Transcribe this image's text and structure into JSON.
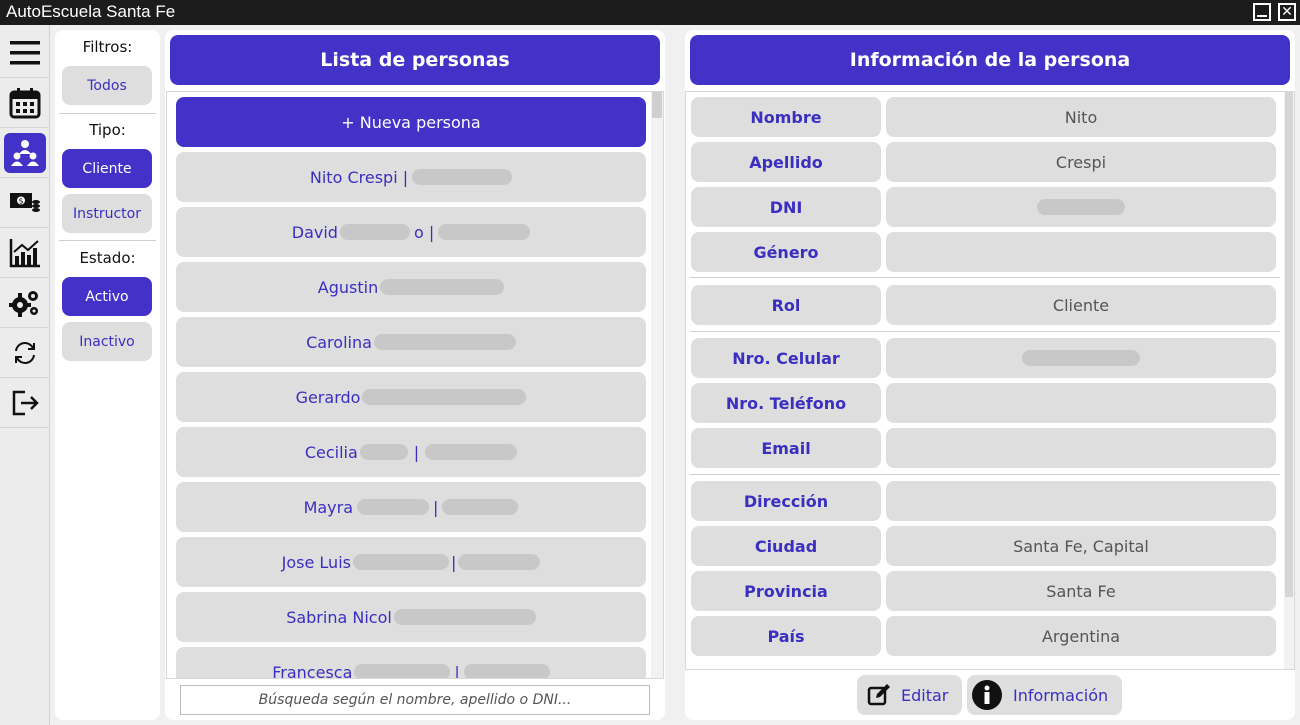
{
  "window": {
    "title": "AutoEscuela Santa Fe"
  },
  "nav": {
    "items": [
      {
        "name": "menu-icon"
      },
      {
        "name": "calendar-icon"
      },
      {
        "name": "people-icon",
        "active": true
      },
      {
        "name": "money-icon"
      },
      {
        "name": "chart-icon"
      },
      {
        "name": "settings-icon"
      },
      {
        "name": "sync-icon"
      },
      {
        "name": "logout-icon"
      }
    ]
  },
  "filters": {
    "title": "Filtros:",
    "all": "Todos",
    "type_label": "Tipo:",
    "type_options": [
      "Cliente",
      "Instructor"
    ],
    "state_label": "Estado:",
    "state_options": [
      "Activo",
      "Inactivo"
    ],
    "selected_type": "Cliente",
    "selected_state": "Activo"
  },
  "list": {
    "header": "Lista de personas",
    "new_button": "+ Nueva persona",
    "people": [
      {
        "label": "Nito Crespi |"
      },
      {
        "label": "David"
      },
      {
        "label": "Agustin"
      },
      {
        "label": "Carolina"
      },
      {
        "label": "Gerardo"
      },
      {
        "label": "Cecilia"
      },
      {
        "label": "Mayra"
      },
      {
        "label": "Jose Luis"
      },
      {
        "label": "Sabrina Nicol"
      },
      {
        "label": "Francesca"
      }
    ],
    "search_placeholder": "Búsqueda según el nombre, apellido o DNI..."
  },
  "info": {
    "header": "Información de la persona",
    "fields": {
      "nombre": {
        "label": "Nombre",
        "value": "Nito"
      },
      "apellido": {
        "label": "Apellido",
        "value": "Crespi"
      },
      "dni": {
        "label": "DNI",
        "value": ""
      },
      "genero": {
        "label": "Género",
        "value": ""
      },
      "rol": {
        "label": "Rol",
        "value": "Cliente"
      },
      "celular": {
        "label": "Nro. Celular",
        "value": ""
      },
      "telefono": {
        "label": "Nro. Teléfono",
        "value": ""
      },
      "email": {
        "label": "Email",
        "value": ""
      },
      "direccion": {
        "label": "Dirección",
        "value": ""
      },
      "ciudad": {
        "label": "Ciudad",
        "value": "Santa Fe, Capital"
      },
      "provincia": {
        "label": "Provincia",
        "value": "Santa Fe"
      },
      "pais": {
        "label": "País",
        "value": "Argentina"
      }
    },
    "edit_button": "Editar",
    "info_button": "Información"
  },
  "colors": {
    "accent": "#4232c8",
    "row_bg": "#dedede",
    "text_accent": "#3a2fc0"
  }
}
